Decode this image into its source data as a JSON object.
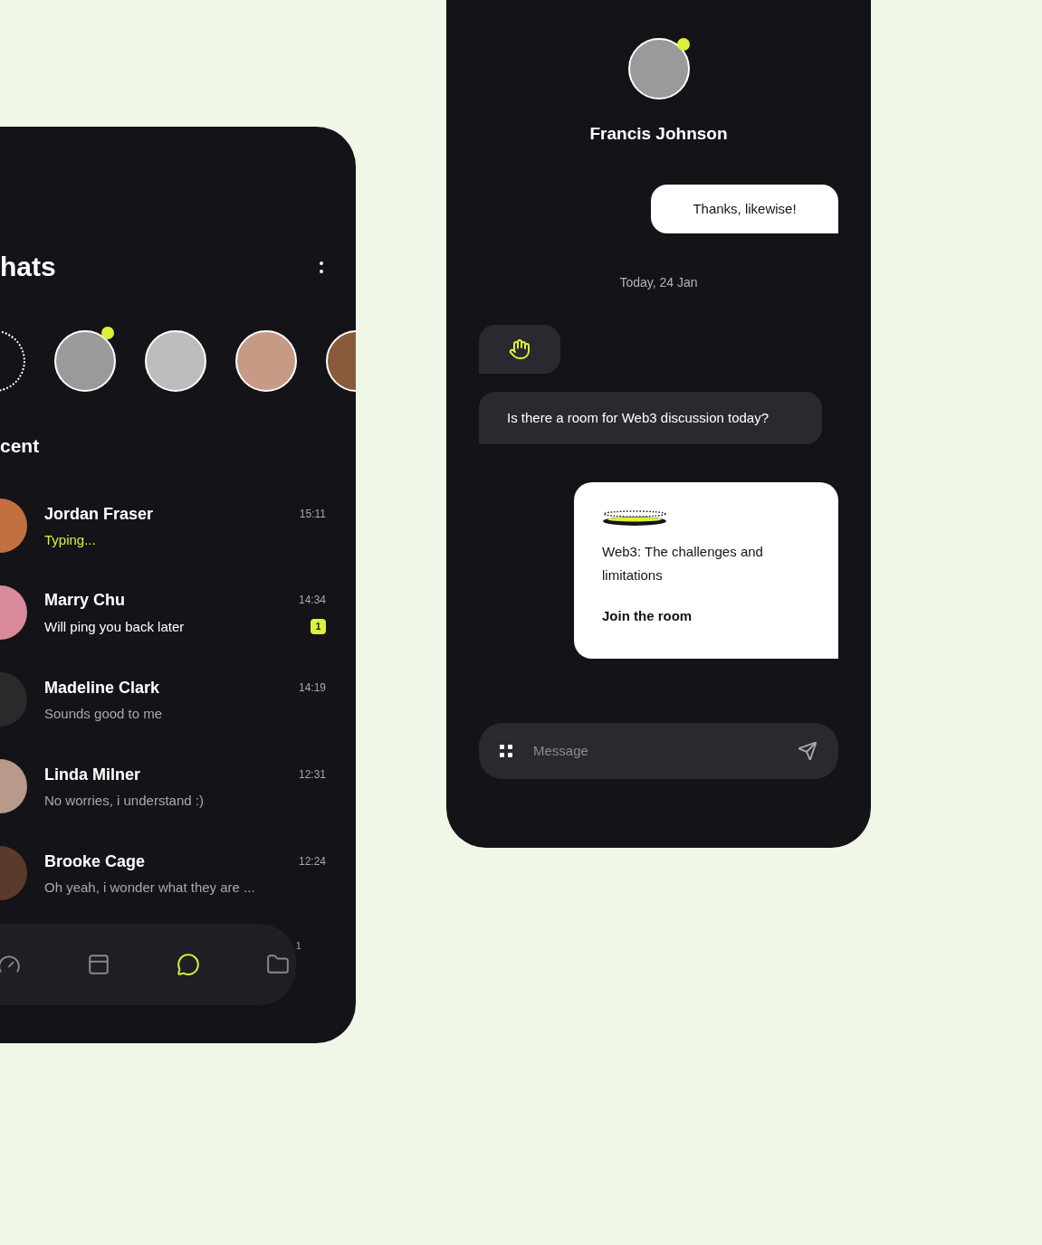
{
  "chats_screen": {
    "title": "hats",
    "stories": [
      {
        "kind": "add"
      },
      {
        "kind": "avatar",
        "online": true
      },
      {
        "kind": "avatar",
        "online": false
      },
      {
        "kind": "avatar",
        "online": false
      },
      {
        "kind": "avatar",
        "online": false
      }
    ],
    "section": "cent",
    "chats": [
      {
        "name": "Jordan Fraser",
        "time": "15:11",
        "preview": "Typing...",
        "typing": true
      },
      {
        "name": "Marry Chu",
        "time": "14:34",
        "preview": "Will ping you back later",
        "typing": false,
        "unread": "1"
      },
      {
        "name": "Madeline Clark",
        "time": "14:19",
        "preview": "Sounds good to me",
        "typing": false
      },
      {
        "name": "Linda Milner",
        "time": "12:31",
        "preview": "No worries, i understand :)",
        "typing": false
      },
      {
        "name": "Brooke Cage",
        "time": "12:24",
        "preview": "Oh yeah, i wonder what they are ...",
        "typing": false
      }
    ],
    "nav": [
      {
        "selected": false
      },
      {
        "selected": false
      },
      {
        "selected": true
      },
      {
        "selected": false
      }
    ],
    "nav_side_count": "1"
  },
  "conversation": {
    "contact": {
      "name": "Francis Johnson",
      "online": true
    },
    "messages": [
      {
        "kind": "outgoing",
        "text": "Thanks, likewise!"
      },
      {
        "kind": "date",
        "text": "Today, 24 Jan"
      },
      {
        "kind": "wave"
      },
      {
        "kind": "incoming",
        "text": "Is there a room for Web3 discussion today?"
      },
      {
        "kind": "card",
        "title": "Web3: The challenges and limitations",
        "action": "Join the room"
      }
    ],
    "composer": {
      "placeholder": "Message"
    }
  }
}
